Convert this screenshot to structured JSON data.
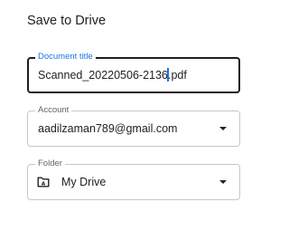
{
  "dialog": {
    "title": "Save to Drive"
  },
  "document_title": {
    "label": "Document title",
    "value_before_cursor": "Scanned_20220506-2136",
    "value_after_cursor": ".pdf"
  },
  "account": {
    "label": "Account",
    "value": "aadilzaman789@gmail.com",
    "icon": "dropdown-arrow-icon"
  },
  "folder": {
    "label": "Folder",
    "value": "My Drive",
    "icon": "drive-folder-icon",
    "dropdown_icon": "dropdown-arrow-icon"
  },
  "colors": {
    "focus_label": "#1a73e8",
    "focused_border": "#1f1f1f",
    "border": "#c7c7c7",
    "text": "#202124"
  }
}
